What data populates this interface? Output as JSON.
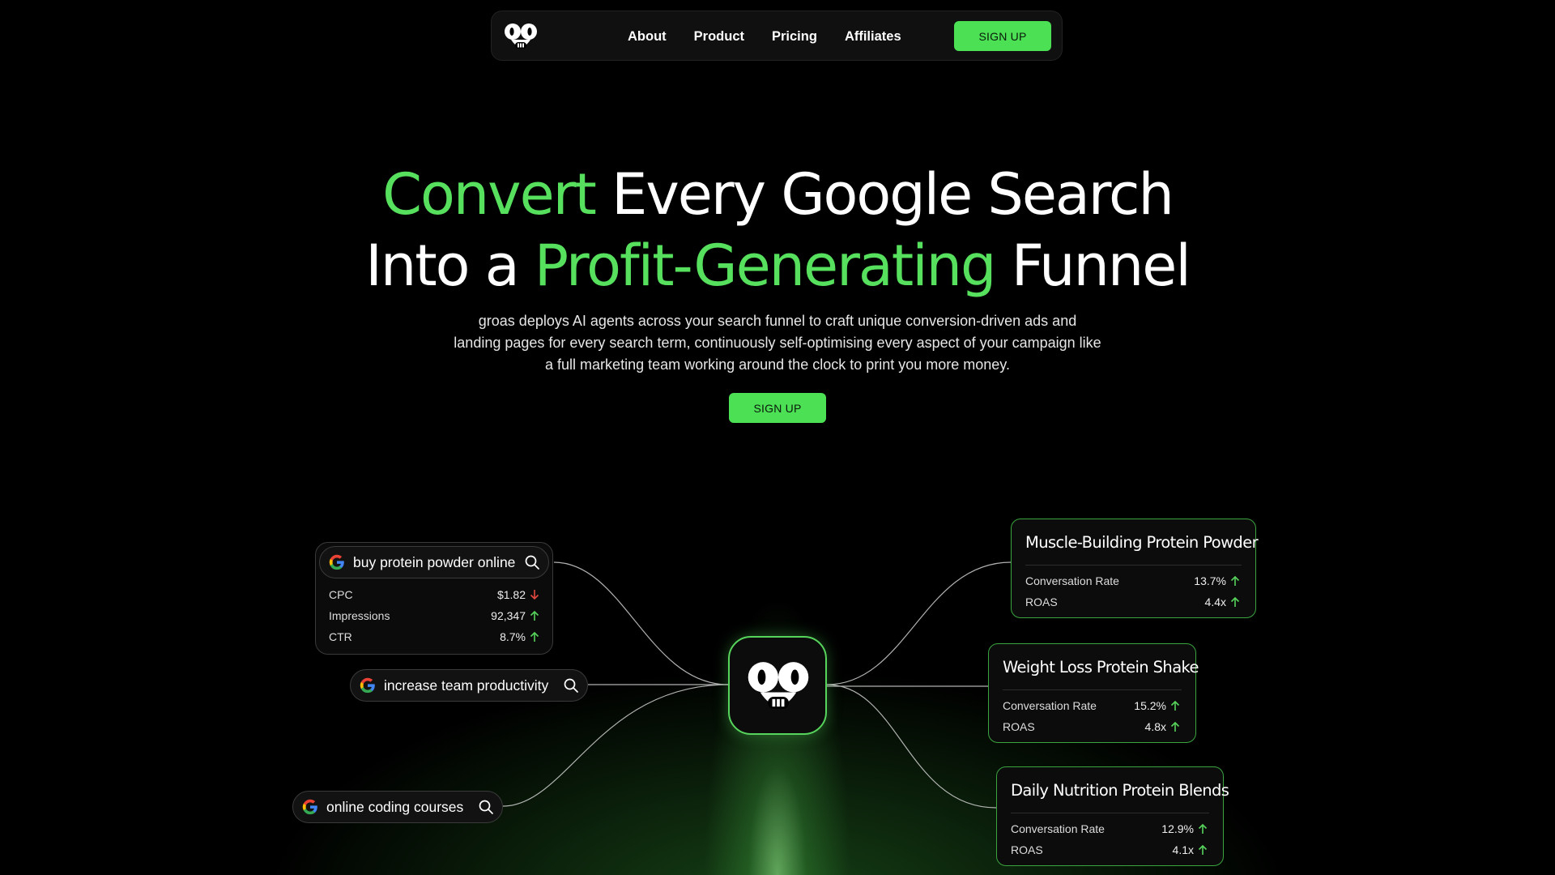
{
  "nav": {
    "links": [
      "About",
      "Product",
      "Pricing",
      "Affiliates"
    ],
    "signup_label": "SIGN UP"
  },
  "hero": {
    "line1_green": "Convert",
    "line1_rest": "Every Google Search",
    "line2_start": "Into a",
    "line2_green": "Profit-Generating",
    "line2_end": "Funnel",
    "subtitle": "groas deploys AI agents across your search funnel to craft unique conversion-driven ads and landing pages for every search term, continuously self-optimising every aspect of your campaign like a full marketing team working around the clock to print you more money.",
    "signup_label": "SIGN UP"
  },
  "queries": [
    {
      "text": "buy protein powder online",
      "metrics": [
        {
          "label": "CPC",
          "value": "$1.82",
          "trend": "down"
        },
        {
          "label": "Impressions",
          "value": "92,347",
          "trend": "up"
        },
        {
          "label": "CTR",
          "value": "8.7%",
          "trend": "up"
        }
      ]
    },
    {
      "text": "increase team productivity"
    },
    {
      "text": "online coding courses"
    }
  ],
  "results": [
    {
      "title": "Muscle-Building Protein Powder",
      "metrics": [
        {
          "label": "Conversation Rate",
          "value": "13.7%",
          "trend": "up"
        },
        {
          "label": "ROAS",
          "value": "4.4x",
          "trend": "up"
        }
      ]
    },
    {
      "title": "Weight Loss Protein Shake",
      "metrics": [
        {
          "label": "Conversation Rate",
          "value": "15.2%",
          "trend": "up"
        },
        {
          "label": "ROAS",
          "value": "4.8x",
          "trend": "up"
        }
      ]
    },
    {
      "title": "Daily Nutrition Protein Blends",
      "metrics": [
        {
          "label": "Conversation Rate",
          "value": "12.9%",
          "trend": "up"
        },
        {
          "label": "ROAS",
          "value": "4.1x",
          "trend": "up"
        }
      ]
    }
  ],
  "icons": {
    "logo": "robot-face-icon",
    "search": "search-icon",
    "google": "google-g-icon",
    "trend_up": "arrow-up-icon",
    "trend_down": "arrow-down-icon"
  },
  "colors": {
    "accent": "#56e05d",
    "button": "#4ce055",
    "trend_up": "#57d45c",
    "trend_down": "#e5483f",
    "background": "#000000"
  }
}
